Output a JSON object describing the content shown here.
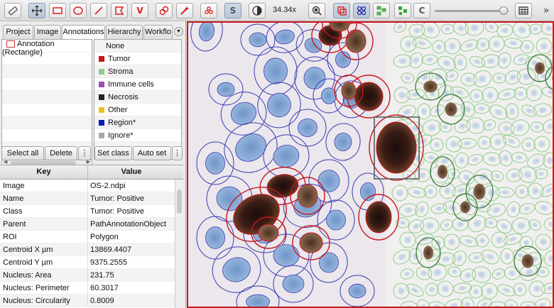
{
  "toolbar": {
    "zoom": "34.34x",
    "tools": [
      {
        "name": "measure-icon"
      },
      {
        "name": "move-icon"
      },
      {
        "name": "rectangle-icon"
      },
      {
        "name": "ellipse-icon"
      },
      {
        "name": "line-icon"
      },
      {
        "name": "polygon-icon"
      },
      {
        "name": "polyline-icon",
        "glyph": "V"
      },
      {
        "name": "brush-icon"
      },
      {
        "name": "wand-icon"
      },
      {
        "name": "points-icon"
      },
      {
        "name": "show-annotations-icon",
        "glyph": "S"
      },
      {
        "name": "contrast-icon"
      },
      {
        "name": "zoom-to-fit-icon"
      },
      {
        "name": "fill-annotations-icon"
      },
      {
        "name": "show-detections-icon"
      },
      {
        "name": "tma-grid-icon"
      },
      {
        "name": "cell-boundaries-icon"
      },
      {
        "name": "show-names-icon",
        "glyph": "C"
      },
      {
        "name": "grid-icon"
      },
      {
        "name": "expand-toolbar-icon",
        "glyph": "»"
      }
    ],
    "zoom_slider_fraction": 0.9
  },
  "tabs": [
    "Project",
    "Image",
    "Annotations",
    "Hierarchy",
    "Workflo"
  ],
  "selected_tab": "Annotations",
  "annotations": [
    "Annotation (Rectangle)"
  ],
  "classes": {
    "none_label": "None",
    "items": [
      {
        "label": "Tumor",
        "color": "#c8161d"
      },
      {
        "label": "Stroma",
        "color": "#8fcc8f"
      },
      {
        "label": "Immune cells",
        "color": "#a050b0"
      },
      {
        "label": "Necrosis",
        "color": "#222222"
      },
      {
        "label": "Other",
        "color": "#f0c020"
      },
      {
        "label": "Region*",
        "color": "#0a1fb0"
      },
      {
        "label": "Ignore*",
        "color": "#a8a8a8"
      }
    ]
  },
  "buttons": {
    "select_all": "Select all",
    "delete": "Delete",
    "more": "⋮",
    "set_class": "Set class",
    "auto_set": "Auto set",
    "more2": "⋮"
  },
  "table": {
    "headers": {
      "key": "Key",
      "value": "Value"
    },
    "rows": [
      {
        "key": "Image",
        "value": "OS-2.ndpi"
      },
      {
        "key": "Name",
        "value": "Tumor: Positive"
      },
      {
        "key": "Class",
        "value": "Tumor: Positive"
      },
      {
        "key": "Parent",
        "value": "PathAnnotationObject"
      },
      {
        "key": "ROI",
        "value": "Polygon"
      },
      {
        "key": "Centroid X µm",
        "value": "13869.4407"
      },
      {
        "key": "Centroid Y µm",
        "value": "9375.2555"
      },
      {
        "key": "Nucleus: Area",
        "value": "231.75"
      },
      {
        "key": "Nucleus: Perimeter",
        "value": "60.3017"
      },
      {
        "key": "Nucleus: Circularity",
        "value": "0.8009"
      }
    ]
  },
  "viewer": {
    "annotation_color": "#c8161d",
    "tumor_cell_color": "#c8161d",
    "negative_cell_color": "#3c3cb4",
    "stroma_cell_color": "#8fcc8f",
    "selected_cell_color": "#555555"
  }
}
